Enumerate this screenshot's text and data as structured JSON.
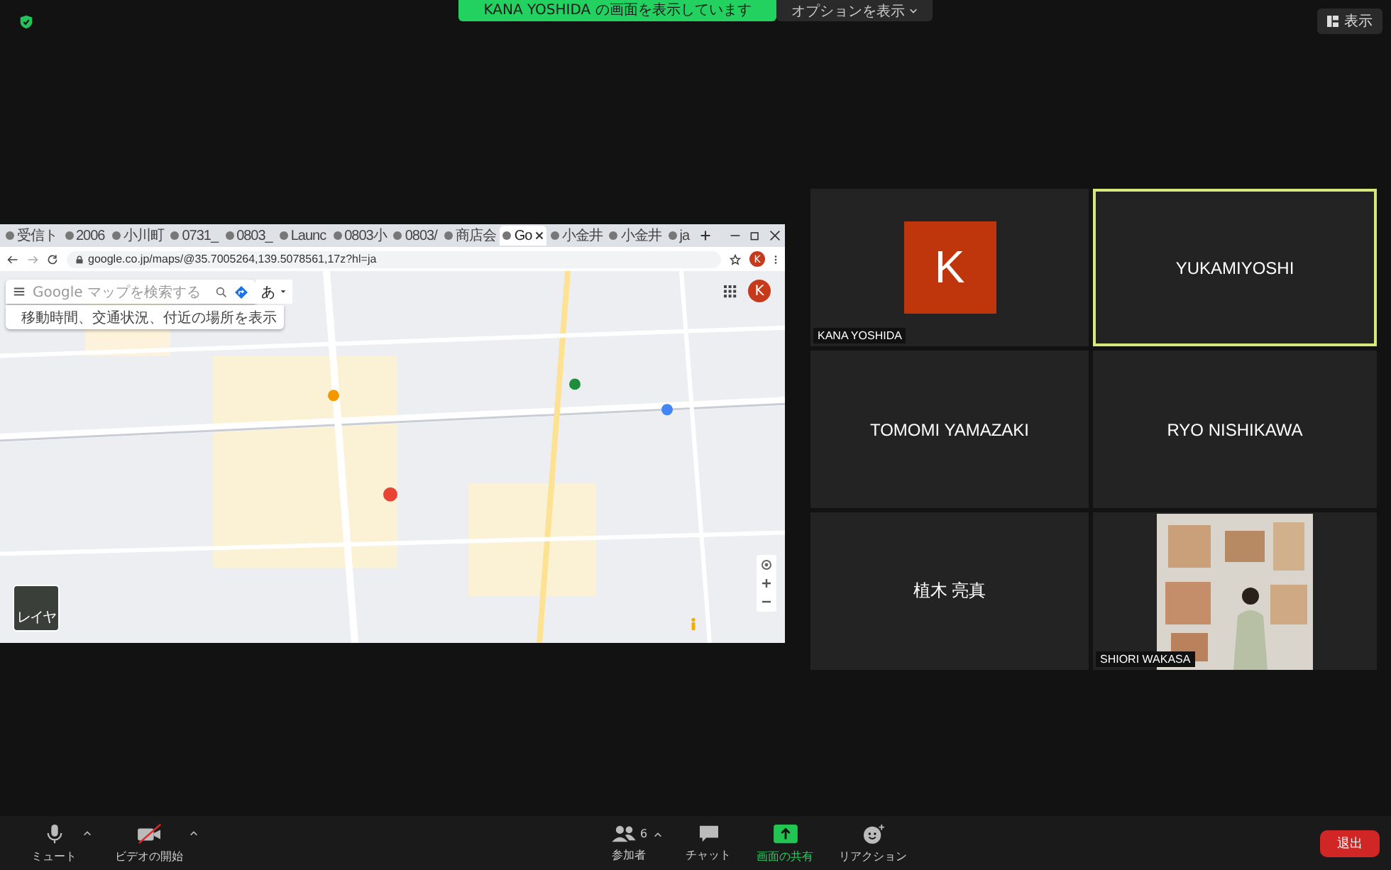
{
  "top_bar": {
    "sharing_banner": "KANA YOSHIDA の画面を表示しています",
    "options": "オプションを表示",
    "view_button": "表示"
  },
  "shared_screen": {
    "tabs": [
      {
        "label": "受信ト",
        "selected": false
      },
      {
        "label": "2006",
        "selected": false
      },
      {
        "label": "小川町",
        "selected": false
      },
      {
        "label": "0731_",
        "selected": false
      },
      {
        "label": "0803_",
        "selected": false
      },
      {
        "label": "Launc",
        "selected": false
      },
      {
        "label": "0803小",
        "selected": false
      },
      {
        "label": "0803/",
        "selected": false
      },
      {
        "label": "商店会",
        "selected": false
      },
      {
        "label": "Go",
        "selected": true
      },
      {
        "label": "小金井",
        "selected": false
      },
      {
        "label": "小金井",
        "selected": false
      },
      {
        "label": "ja",
        "selected": false
      }
    ],
    "url": "google.co.jp/maps/@35.7005264,139.5078561,17z?hl=ja",
    "profile_initial": "K",
    "map": {
      "search_placeholder": "Google マップを検索する",
      "language_button": "あ",
      "hint": "移動時間、交通状況、付近の場所を表示",
      "layer_label": "レイヤ",
      "account_initial": "K"
    }
  },
  "participants": [
    {
      "kind": "avatar",
      "initial": "K",
      "label": "KANA YOSHIDA",
      "speaking": false
    },
    {
      "kind": "name",
      "name": "YUKAMIYOSHI",
      "speaking": true
    },
    {
      "kind": "name",
      "name": "TOMOMI YAMAZAKI",
      "speaking": false
    },
    {
      "kind": "name",
      "name": "RYO NISHIKAWA",
      "speaking": false
    },
    {
      "kind": "name",
      "name": "植木 亮真",
      "speaking": false
    },
    {
      "kind": "video",
      "label": "SHIORI WAKASA",
      "speaking": false
    }
  ],
  "toolbar": {
    "left": [
      {
        "kind": "mic",
        "label": "ミュート",
        "has_menu": true
      },
      {
        "kind": "camera_off",
        "label": "ビデオの開始",
        "has_menu": true
      }
    ],
    "center": [
      {
        "kind": "participants",
        "label": "参加者",
        "count": "6",
        "has_menu": true,
        "active": false
      },
      {
        "kind": "chat",
        "label": "チャット",
        "has_menu": false,
        "active": false
      },
      {
        "kind": "share",
        "label": "画面の共有",
        "has_menu": false,
        "active": true
      },
      {
        "kind": "reaction",
        "label": "リアクション",
        "has_menu": false,
        "active": false
      }
    ],
    "leave_button": "退出"
  }
}
